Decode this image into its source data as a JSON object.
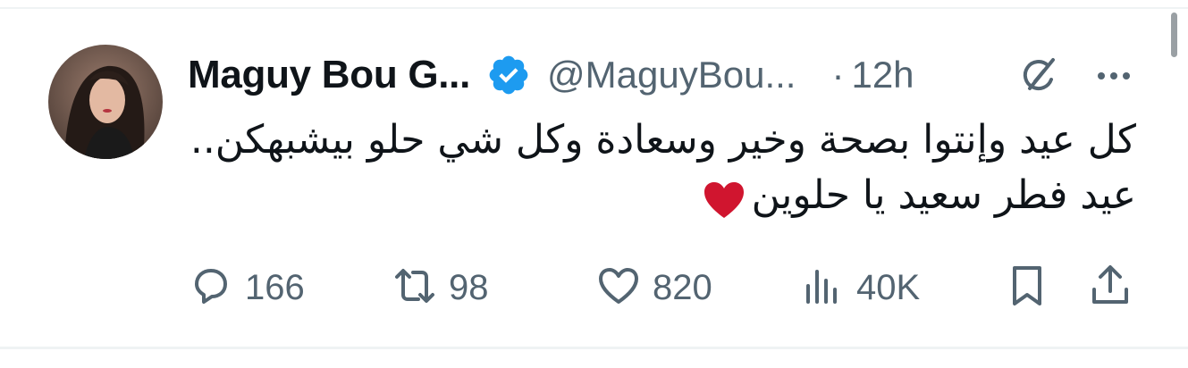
{
  "author": {
    "display_name": "Maguy Bou G...",
    "handle": "@MaguyBou...",
    "verified": true,
    "avatar": "profile-photo"
  },
  "meta": {
    "separator": "·",
    "timestamp": "12h"
  },
  "tweet": {
    "lines": [
      "كل عيد وإنتوا بصحة وخير وسعادة وكل شي حلو بيشبهكن..",
      "عيد فطر سعيد يا حلوين"
    ],
    "emoji": "red-heart"
  },
  "actions": {
    "replies": "166",
    "reposts": "98",
    "likes": "820",
    "views": "40K"
  },
  "icons": {
    "reply": "reply-bubble-icon",
    "repost": "repost-icon",
    "like": "heart-outline-icon",
    "views": "views-bars-icon",
    "bookmark": "bookmark-icon",
    "share": "share-icon",
    "grok": "grok-icon",
    "more": "more-dots-icon",
    "verified": "verified-badge-icon"
  },
  "colors": {
    "text": "#0f1419",
    "secondary": "#536471",
    "verified_blue": "#1d9bf0",
    "heart_red": "#d0152f",
    "divider": "#eff3f4"
  }
}
